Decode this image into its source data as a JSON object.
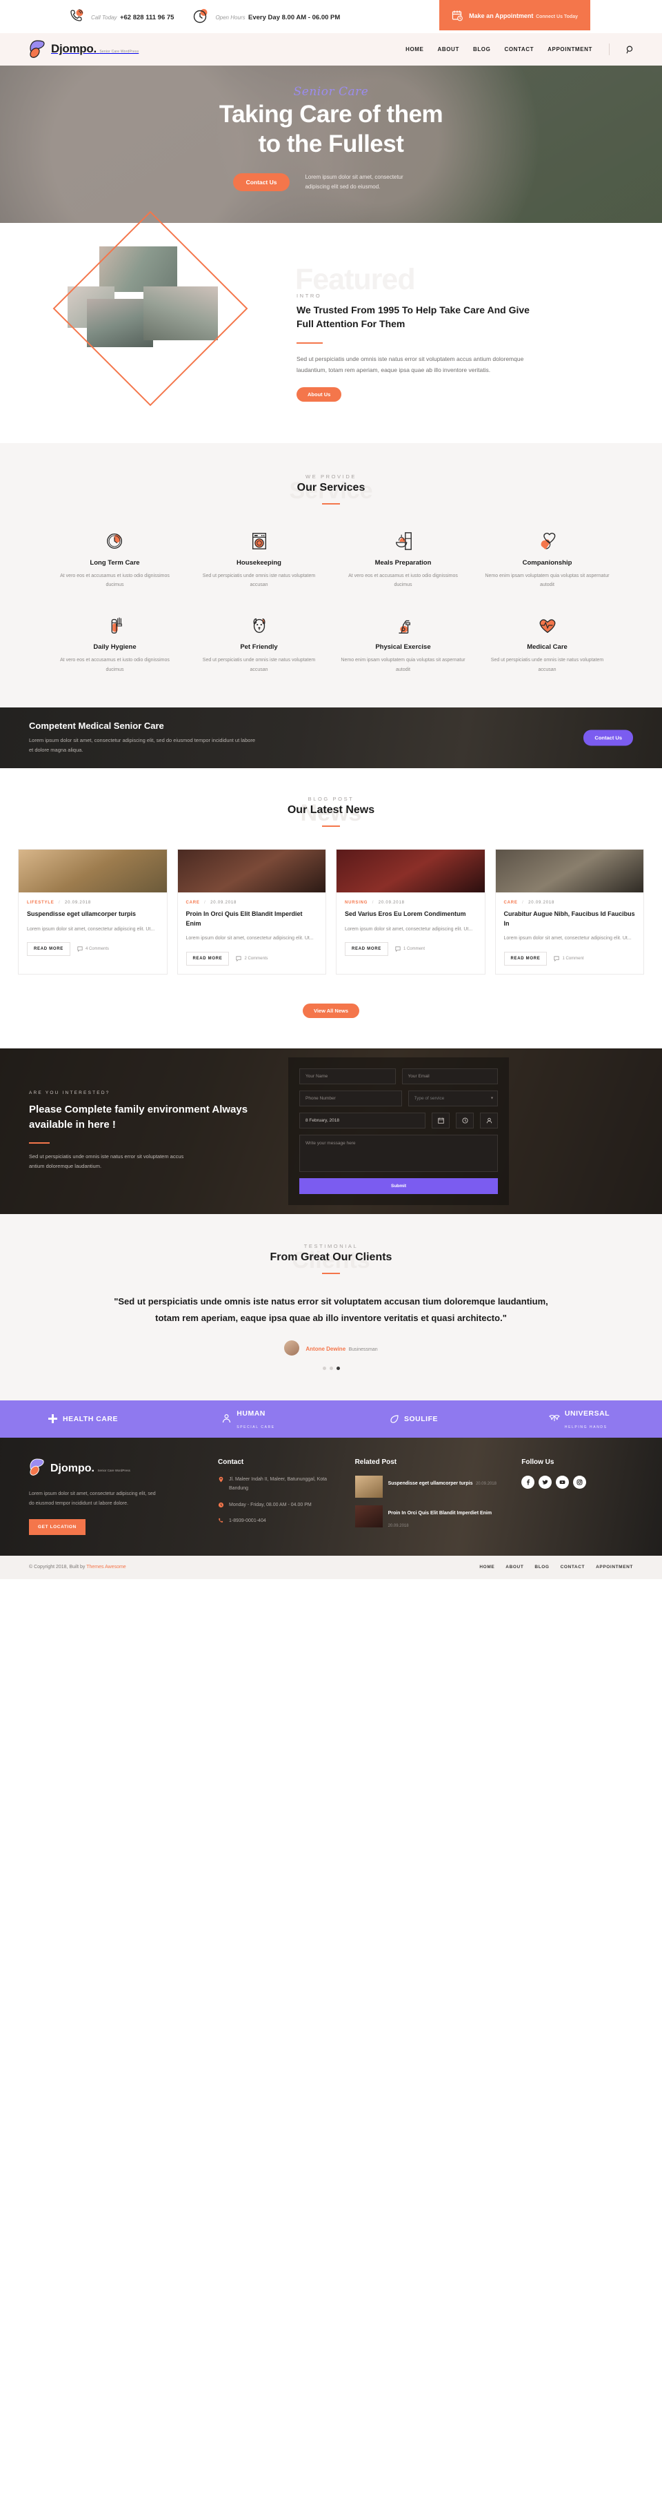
{
  "topbar": {
    "call_label": "Call Today",
    "call_value": "+62 828 111 96 75",
    "hours_label": "Open Hours",
    "hours_value": "Every Day 8.00 AM - 06.00 PM",
    "appointment_title": "Make an Appointment",
    "appointment_sub": "Connect Us Today"
  },
  "brand": {
    "name": "Djompo.",
    "tagline": "Senior Care WordPress"
  },
  "nav": {
    "items": [
      "HOME",
      "ABOUT",
      "BLOG",
      "CONTACT",
      "APPOINTMENT"
    ],
    "search_icon": "search-icon"
  },
  "hero": {
    "script": "Senior Care",
    "title_line1": "Taking Care of them",
    "title_line2": "to the Fullest",
    "cta": "Contact Us",
    "paragraph": "Lorem ipsum dolor sit amet, consectetur adipiscing elit sed do eiusmod."
  },
  "intro": {
    "ghost": "Featured",
    "eyebrow": "INTRO",
    "heading": "We Trusted From 1995 To Help Take Care And Give Full Attention For Them",
    "paragraph": "Sed ut perspiciatis unde omnis iste natus error sit voluptatem accus antium doloremque laudantium, totam rem aperiam, eaque ipsa quae ab illo inventore veritatis.",
    "button": "About Us"
  },
  "services": {
    "ghost": "Service",
    "eyebrow": "WE PROVIDE",
    "title": "Our Services",
    "items": [
      {
        "icon": "clock-icon",
        "name": "Long Term Care",
        "desc": "At vero eos et accusamus et iusto odio dignissimos ducimus"
      },
      {
        "icon": "washing-machine-icon",
        "name": "Housekeeping",
        "desc": "Sed ut perspiciatis unde omnis iste natus voluptatem accusan"
      },
      {
        "icon": "meal-icon",
        "name": "Meals Preparation",
        "desc": "At vero eos et accusamus et iusto odio dignissimos ducimus"
      },
      {
        "icon": "hands-heart-icon",
        "name": "Companionship",
        "desc": "Nemo enim ipsam voluptatem quia voluptas sit aspernatur autodit"
      },
      {
        "icon": "toothbrush-icon",
        "name": "Daily Hygiene",
        "desc": "At vero eos et accusamus et iusto odio dignissimos ducimus"
      },
      {
        "icon": "dog-icon",
        "name": "Pet Friendly",
        "desc": "Sed ut perspiciatis unde omnis iste natus voluptatem accusan"
      },
      {
        "icon": "exercise-bike-icon",
        "name": "Physical Exercise",
        "desc": "Nemo enim ipsam voluptatem quia voluptas sit aspernatur autodit"
      },
      {
        "icon": "heart-pulse-icon",
        "name": "Medical Care",
        "desc": "Sed ut perspiciatis unde omnis iste natus voluptatem accusan"
      }
    ]
  },
  "cta_band": {
    "heading": "Competent Medical Senior Care",
    "paragraph": "Lorem ipsum dolor sit amet, consectetur adipiscing elit, sed do eiusmod tempor incididunt ut labore et dolore magna aliqua.",
    "button": "Contact Us"
  },
  "blog": {
    "ghost": "News",
    "eyebrow": "BLOG POST",
    "title": "Our Latest News",
    "view_all": "View All News",
    "read_more": "READ MORE",
    "posts": [
      {
        "category": "LIFESTYLE",
        "date": "20.09.2018",
        "title": "Suspendisse eget ullamcorper turpis",
        "excerpt": "Lorem ipsum dolor sit amet, consectetur adipiscing elit. Ut...",
        "comments": "4 Comments"
      },
      {
        "category": "CARE",
        "date": "20.09.2018",
        "title": "Proin In Orci Quis Elit Blandit Imperdiet Enim",
        "excerpt": "Lorem ipsum dolor sit amet, consectetur adipiscing elit. Ut...",
        "comments": "2 Comments"
      },
      {
        "category": "NURSING",
        "date": "20.09.2018",
        "title": "Sed Varius Eros Eu Lorem Condimentum",
        "excerpt": "Lorem ipsum dolor sit amet, consectetur adipiscing elit. Ut...",
        "comments": "1 Comment"
      },
      {
        "category": "CARE",
        "date": "20.09.2018",
        "title": "Curabitur Augue Nibh, Faucibus Id Faucibus In",
        "excerpt": "Lorem ipsum dolor sit amet, consectetur adipiscing elit. Ut...",
        "comments": "1 Comment"
      }
    ]
  },
  "contact": {
    "eyebrow": "ARE YOU INTERESTED?",
    "heading": "Please Complete family environment Always available in here !",
    "paragraph": "Sed ut perspiciatis unde omnis iste natus error sit voluptatem accus antium doloremque laudantium.",
    "form": {
      "name_placeholder": "Your Name",
      "email_placeholder": "Your Email",
      "phone_placeholder": "Phone Number",
      "service_placeholder": "Type of service",
      "date_value": "8 February, 2018",
      "message_placeholder": "Write your message here",
      "submit": "Submit"
    }
  },
  "testimonial": {
    "ghost": "Clients",
    "eyebrow": "TESTIMONIAL",
    "title": "From Great Our Clients",
    "quote": "\"Sed ut perspiciatis unde omnis iste natus error sit voluptatem accusan tium doloremque laudantium, totam rem aperiam, eaque ipsa quae ab illo inventore veritatis et quasi architecto.\"",
    "author": "Antone Dewine",
    "role": "Businessman",
    "dots": 3,
    "active_dot": 2
  },
  "partners": [
    {
      "icon": "cross-icon",
      "name": "HEALTH CARE",
      "sub": ""
    },
    {
      "icon": "people-icon",
      "name": "HUMAN",
      "sub": "SPECIAL CARE"
    },
    {
      "icon": "leaf-icon",
      "name": "SOULIFE",
      "sub": ""
    },
    {
      "icon": "wings-icon",
      "name": "UNIVERSAL",
      "sub": "HELPING HANDS"
    }
  ],
  "footer": {
    "about": "Lorem ipsum dolor sit amet, consectetur adipiscing elit, sed do eiusmod tempor incididunt ut labore dolore.",
    "location_button": "GET LOCATION",
    "contact_head": "Contact",
    "address": "Jl. Maleer Indah II, Maleer, Batununggal, Kota Bandung",
    "hours": "Monday - Friday, 08.00 AM - 04.00 PM",
    "phone": "1-8939-0001-404",
    "related_head": "Related Post",
    "related": [
      {
        "title": "Suspendisse eget ullamcorper turpis",
        "date": "20.09.2018"
      },
      {
        "title": "Proin In Orci Quis Elit Blandit Imperdiet Enim",
        "date": "20.09.2018"
      }
    ],
    "follow_head": "Follow Us",
    "socials": [
      "facebook-icon",
      "twitter-icon",
      "youtube-icon",
      "instagram-icon"
    ]
  },
  "bottom": {
    "copyright_pre": "© Copyright 2018, Built by ",
    "copyright_link": "Themes Awesome",
    "links": [
      "HOME",
      "ABOUT",
      "BLOG",
      "CONTACT",
      "APPOINTMENT"
    ]
  },
  "colors": {
    "accent": "#f4764b",
    "purple": "#7b5cf0",
    "dark": "#262321"
  }
}
